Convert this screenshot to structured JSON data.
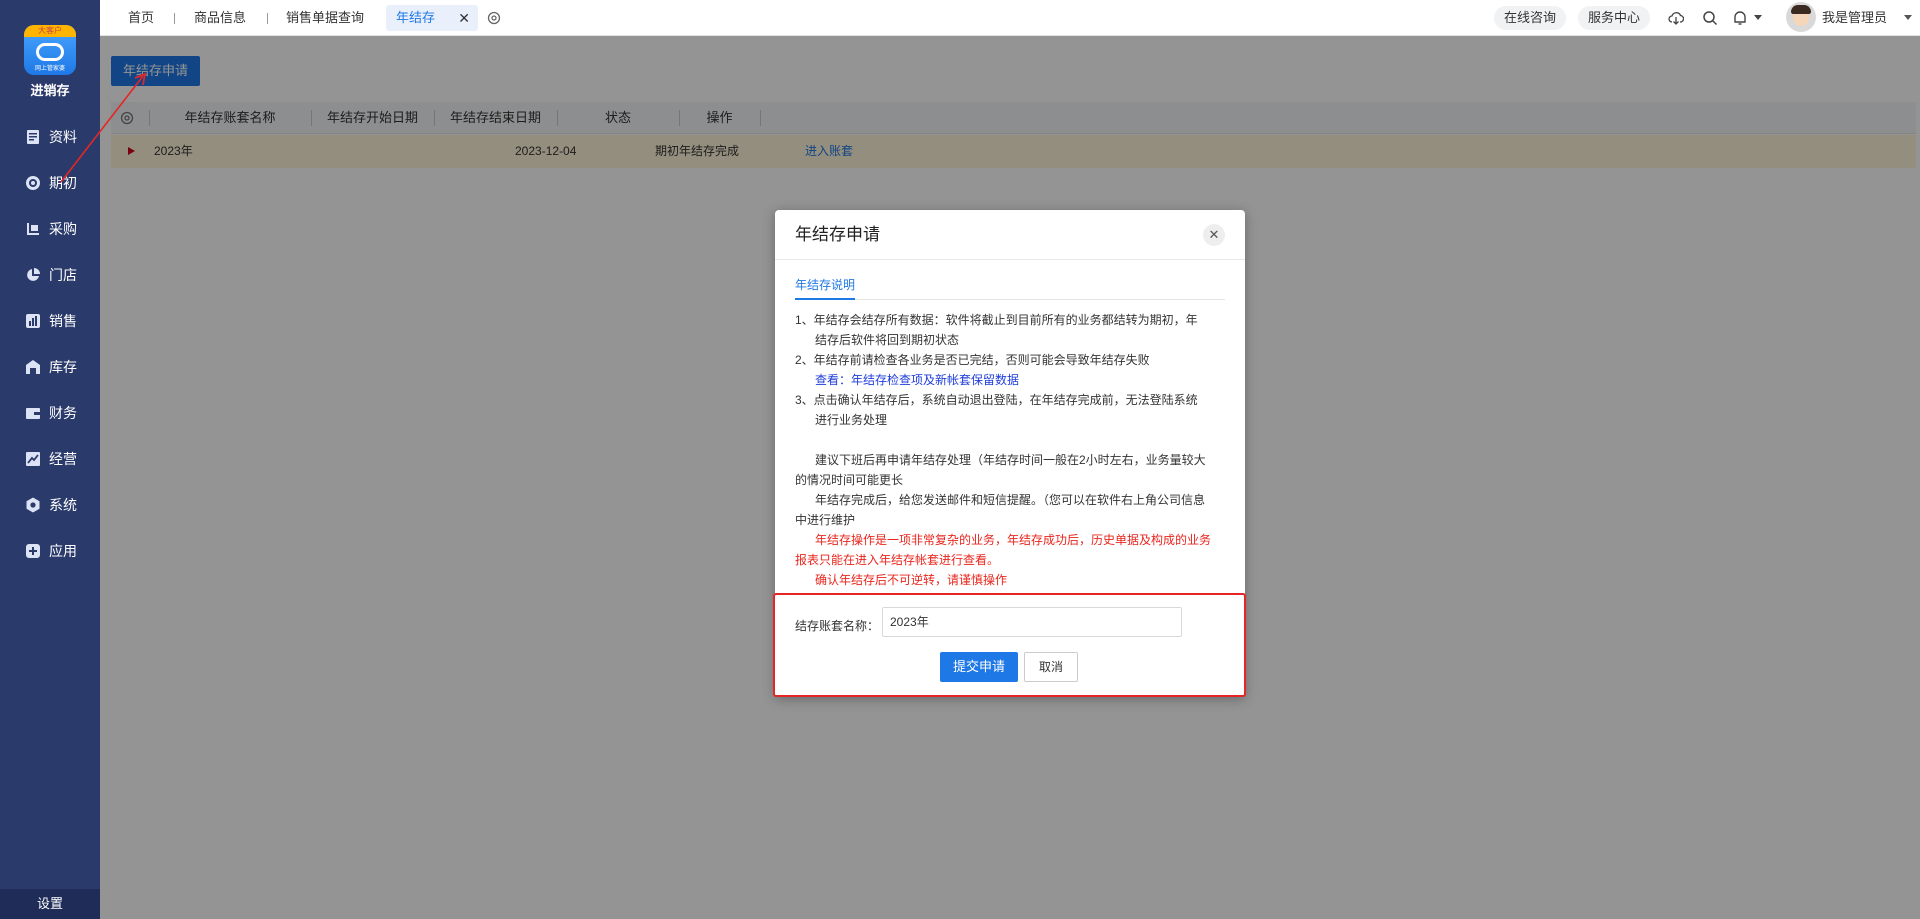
{
  "sidebar": {
    "logo_badge": "大客户",
    "logo_sub": "网上管家婆",
    "logo_text": "进销存",
    "items": [
      {
        "label": "资料",
        "icon": "document-icon"
      },
      {
        "label": "期初",
        "icon": "target-icon"
      },
      {
        "label": "采购",
        "icon": "cart-icon"
      },
      {
        "label": "门店",
        "icon": "pie-icon"
      },
      {
        "label": "销售",
        "icon": "bar-chart-icon"
      },
      {
        "label": "库存",
        "icon": "warehouse-icon"
      },
      {
        "label": "财务",
        "icon": "wallet-icon"
      },
      {
        "label": "经营",
        "icon": "trend-icon"
      },
      {
        "label": "系统",
        "icon": "gear-icon"
      },
      {
        "label": "应用",
        "icon": "plus-icon"
      }
    ],
    "settings": "设置"
  },
  "topbar": {
    "tabs": [
      "首页",
      "商品信息",
      "销售单据查询"
    ],
    "active_tab": "年结存",
    "online_consult": "在线咨询",
    "service_center": "服务中心",
    "user_name": "我是管理员"
  },
  "main": {
    "apply_button": "年结存申请",
    "columns": [
      "年结存账套名称",
      "年结存开始日期",
      "年结存结束日期",
      "状态",
      "操作"
    ],
    "row": {
      "name": "2023年",
      "start": "",
      "end": "2023-12-04",
      "status": "期初年结存完成",
      "action": "进入账套"
    }
  },
  "modal": {
    "title": "年结存申请",
    "tab": "年结存说明",
    "lines": {
      "l1a": "1、年结存会结存所有数据：软件将截止到目前所有的业务都结转为期初，年",
      "l1b": "结存后软件将回到期初状态",
      "l2a": "2、年结存前请检查各业务是否已完结，否则可能会导致年结存失败",
      "l2b": "查看：年结存检查项及新帐套保留数据",
      "l3a": "3、点击确认年结存后，系统自动退出登陆，在年结存完成前，无法登陆系统",
      "l3b": "进行业务处理",
      "p1a": "建议下班后再申请年结存处理（年结存时间一般在2小时左右，业务量较大",
      "p1b": "的情况时间可能更长",
      "p2a": "年结存完成后，给您发送邮件和短信提醒。（您可以在软件右上角公司信息",
      "p2b": "中进行维护",
      "r1a": "年结存操作是一项非常复杂的业务，年结存成功后，历史单据及构成的业务",
      "r1b": "报表只能在进入年结存帐套进行查看。",
      "r2": "确认年结存后不可逆转，请谨慎操作"
    },
    "form_label": "结存账套名称：",
    "form_value": "2023年",
    "submit": "提交申请",
    "cancel": "取消"
  }
}
